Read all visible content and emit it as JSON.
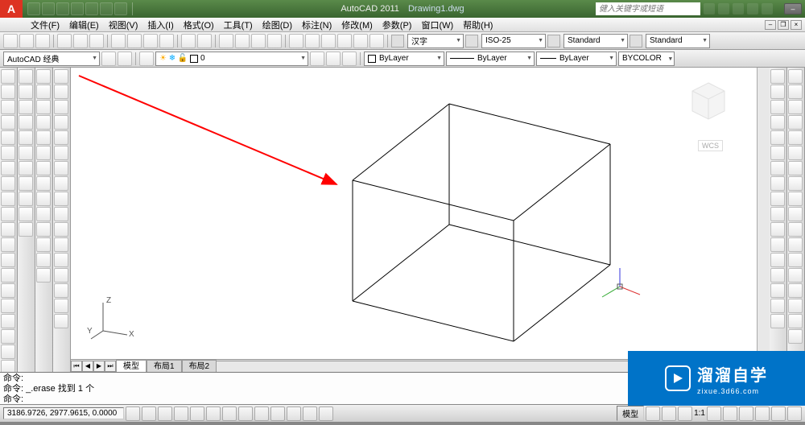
{
  "title": {
    "app": "AutoCAD 2011",
    "file": "Drawing1.dwg"
  },
  "search_placeholder": "健入关键字或短语",
  "menu": [
    "文件(F)",
    "编辑(E)",
    "视图(V)",
    "插入(I)",
    "格式(O)",
    "工具(T)",
    "绘图(D)",
    "标注(N)",
    "修改(M)",
    "参数(P)",
    "窗口(W)",
    "帮助(H)"
  ],
  "styles": {
    "text_style": "汉字",
    "dim_style": "ISO-25",
    "table_style": "Standard",
    "mleader_style": "Standard"
  },
  "workspace": {
    "name": "AutoCAD 经典"
  },
  "layer": {
    "current": "0"
  },
  "props": {
    "color": "ByLayer",
    "linetype": "ByLayer",
    "lineweight": "ByLayer",
    "plotstyle": "BYCOLOR"
  },
  "viewcube": {
    "label": "WCS"
  },
  "ucs": {
    "x": "X",
    "y": "Y",
    "z": "Z"
  },
  "tabs": {
    "model": "模型",
    "layout1": "布局1",
    "layout2": "布局2"
  },
  "command": {
    "line1": "命令:",
    "line2": "命令: _.erase 找到 1 个",
    "line3": "命令:"
  },
  "status": {
    "coords": "3186.9726, 2977.9615, 0.0000",
    "space": "模型",
    "annoscale": "1:1"
  },
  "watermark": {
    "brand": "溜溜自学",
    "url": "zixue.3d66.com"
  }
}
